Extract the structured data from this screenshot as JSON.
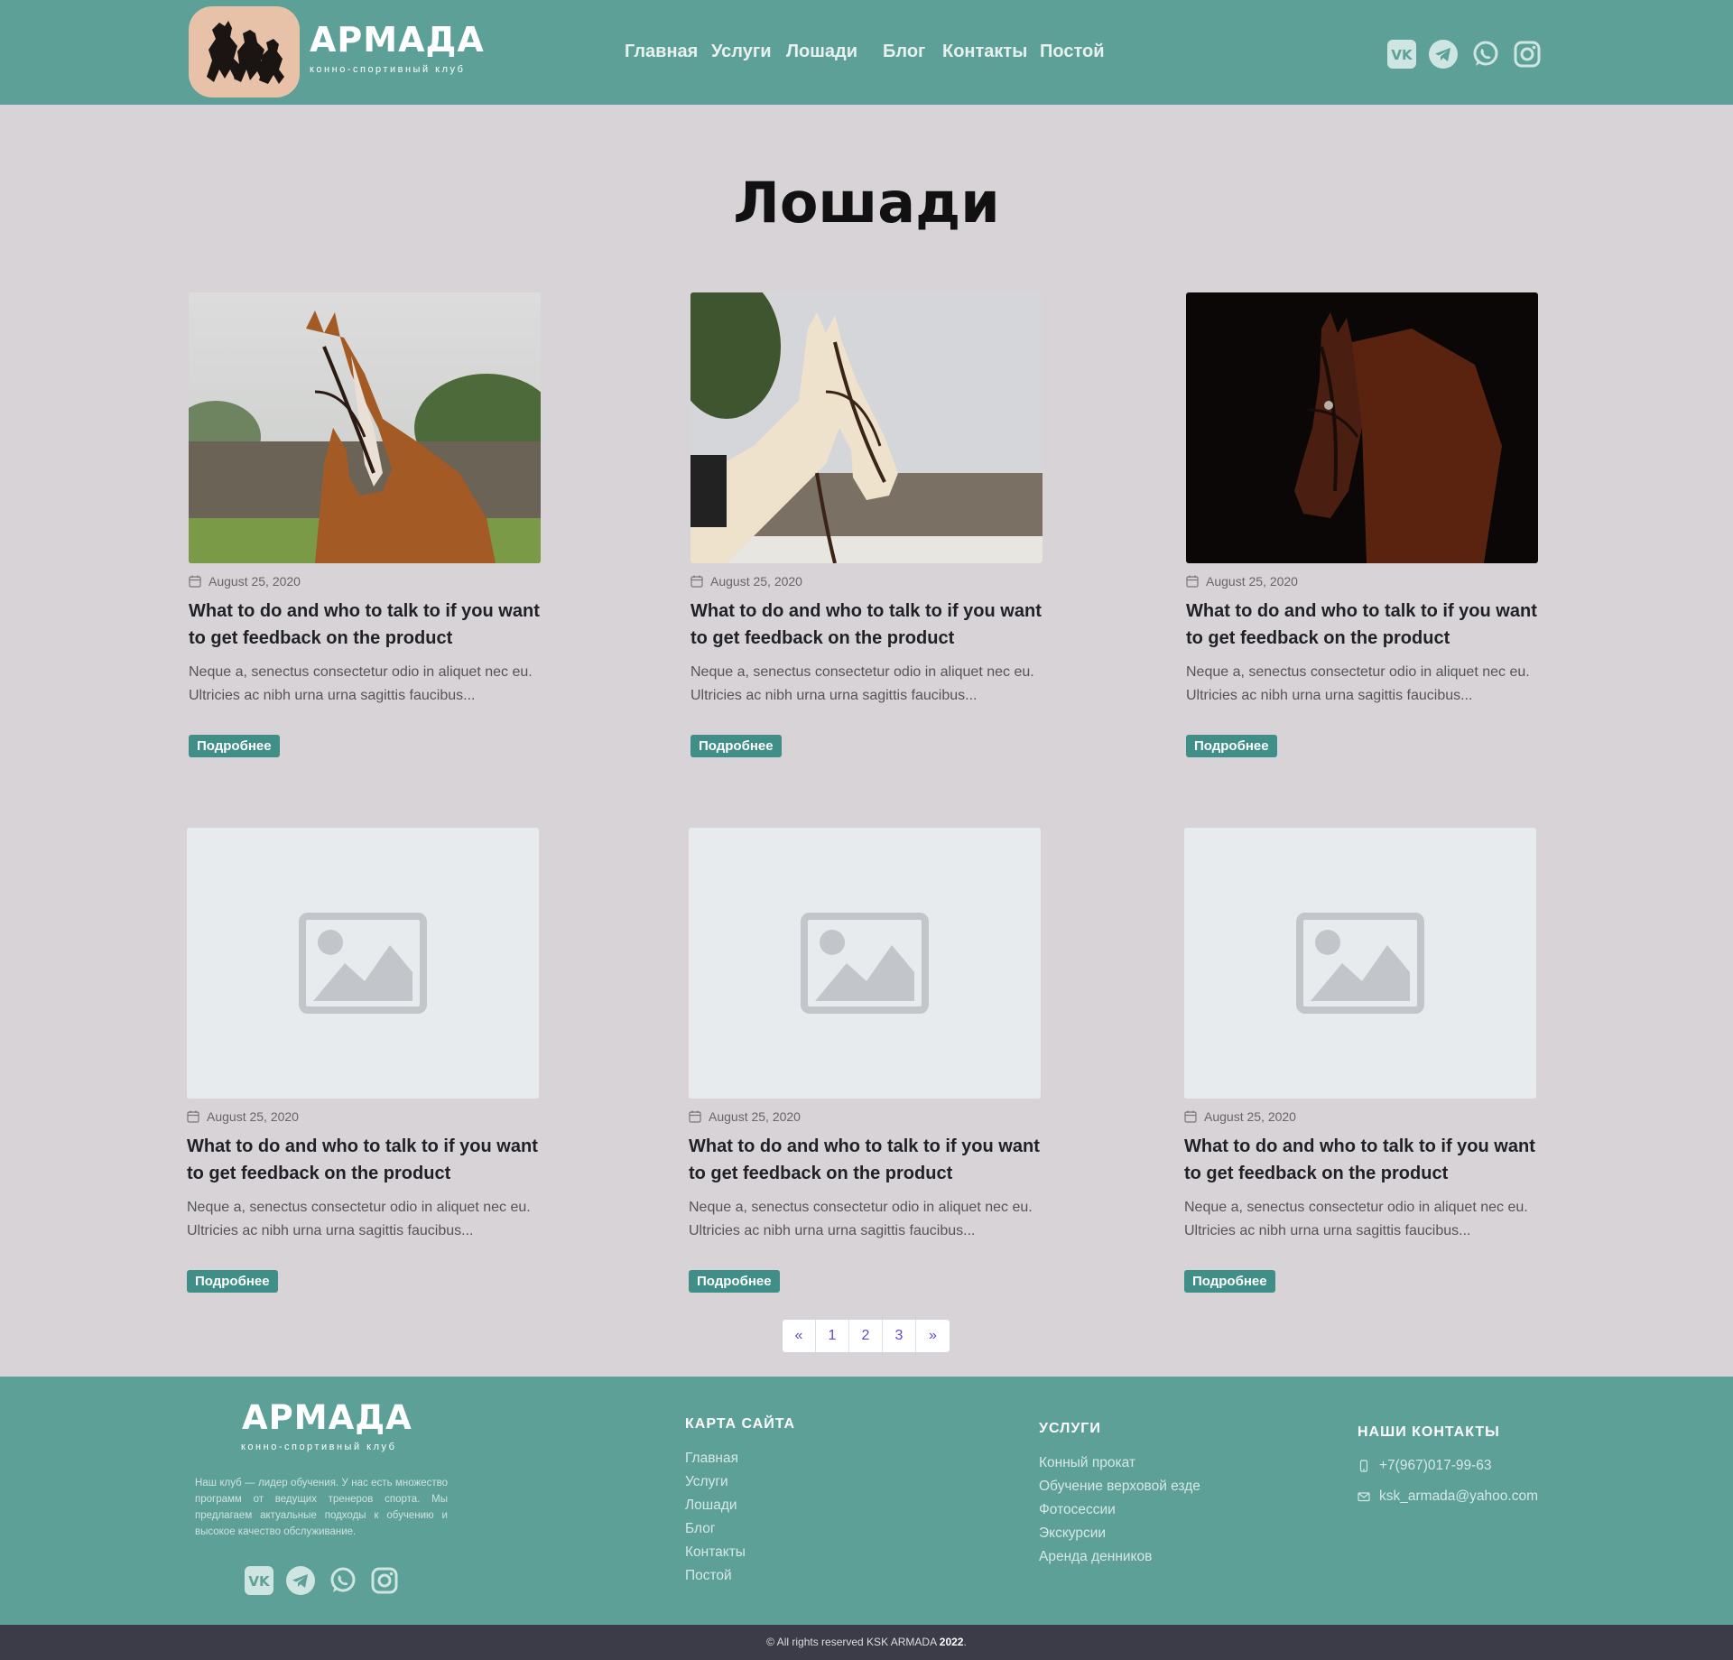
{
  "brand": {
    "name": "АРМАДА",
    "tagline": "конно-спортивный клуб"
  },
  "nav": [
    {
      "label": "Главная"
    },
    {
      "label": "Услуги"
    },
    {
      "label": "Лошади"
    },
    {
      "label": "Блог"
    },
    {
      "label": "Контакты"
    },
    {
      "label": "Постой"
    }
  ],
  "social_icons": [
    "vk-icon",
    "telegram-icon",
    "whatsapp-icon",
    "instagram-icon"
  ],
  "page": {
    "title": "Лошади"
  },
  "posts": [
    {
      "image": "chestnut-horse-photo",
      "date": "August 25, 2020",
      "title": "What to do and who to talk to if you want to get feedback on the product",
      "excerpt": "Neque a, senectus consectetur odio in aliquet nec eu. Ultricies ac nibh urna urna sagittis faucibus...",
      "button": "Подробнее"
    },
    {
      "image": "cream-horse-photo",
      "date": "August 25, 2020",
      "title": "What to do and who to talk to if you want to get feedback on the product",
      "excerpt": "Neque a, senectus consectetur odio in aliquet nec eu. Ultricies ac nibh urna urna sagittis faucibus...",
      "button": "Подробнее"
    },
    {
      "image": "dark-bay-horse-photo",
      "date": "August 25, 2020",
      "title": "What to do and who to talk to if you want to get feedback on the product",
      "excerpt": "Neque a, senectus consectetur odio in aliquet nec eu. Ultricies ac nibh urna urna sagittis faucibus...",
      "button": "Подробнее"
    },
    {
      "image": "image-placeholder-icon",
      "date": "August 25, 2020",
      "title": "What to do and who to talk to if you want to get feedback on the product",
      "excerpt": "Neque a, senectus consectetur odio in aliquet nec eu. Ultricies ac nibh urna urna sagittis faucibus...",
      "button": "Подробнее"
    },
    {
      "image": "image-placeholder-icon",
      "date": "August 25, 2020",
      "title": "What to do and who to talk to if you want to get feedback on the product",
      "excerpt": "Neque a, senectus consectetur odio in aliquet nec eu. Ultricies ac nibh urna urna sagittis faucibus...",
      "button": "Подробнее"
    },
    {
      "image": "image-placeholder-icon",
      "date": "August 25, 2020",
      "title": "What to do and who to talk to if you want to get feedback on the product",
      "excerpt": "Neque a, senectus consectetur odio in aliquet nec eu. Ultricies ac nibh urna urna sagittis faucibus...",
      "button": "Подробнее"
    }
  ],
  "pagination": {
    "prev": "«",
    "pages": [
      "1",
      "2",
      "3"
    ],
    "next": "»"
  },
  "footer": {
    "about": "Наш клуб — лидер обучения. У нас есть множество программ от ведущих тренеров спорта. Мы предлагаем актуальные подходы к обучению и высокое качество обслуживание.",
    "sitemap": {
      "heading": "КАРТА САЙТА",
      "links": [
        "Главная",
        "Услуги",
        "Лошади",
        "Блог",
        "Контакты",
        "Постой"
      ]
    },
    "services": {
      "heading": "УСЛУГИ",
      "links": [
        "Конный прокат",
        "Обучение верховой езде",
        "Фотосессии",
        "Экскурсии",
        "Аренда денников"
      ]
    },
    "contacts": {
      "heading": "НАШИ КОНТАКТЫ",
      "phone": "+7(967)017-99-63",
      "email": "ksk_armada@yahoo.com"
    }
  },
  "copyright": {
    "text": "© All rights reserved KSK ARMADA",
    "year": "2022",
    "suffix": "."
  },
  "colors": {
    "header_bg": "#5ca098",
    "page_bg": "#d8d3d7",
    "button_bg": "#3f8f88",
    "logo_badge": "#e8c1a9",
    "copyright_bg": "#3b3c47"
  }
}
